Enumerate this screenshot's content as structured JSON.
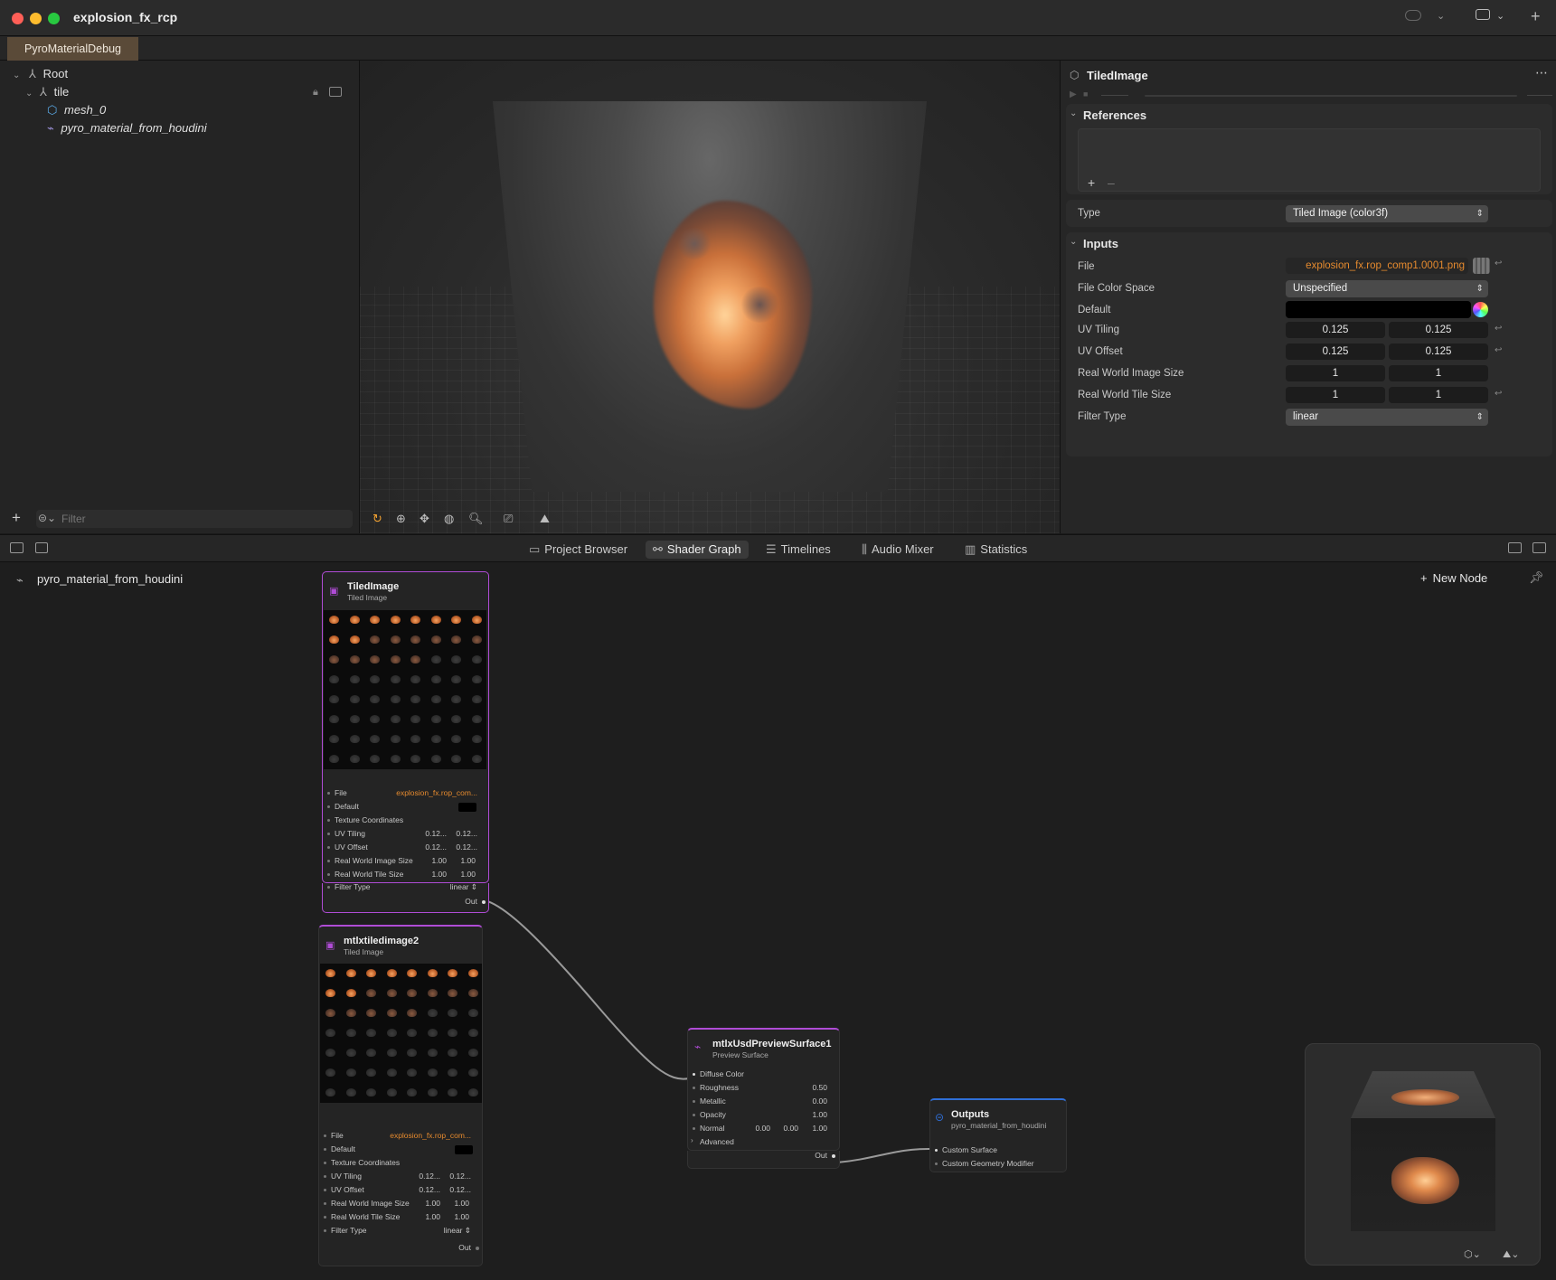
{
  "window": {
    "title": "explosion_fx_rcp"
  },
  "doc_tab": {
    "label": "PyroMaterialDebug"
  },
  "outliner": {
    "items": [
      {
        "label": "Root"
      },
      {
        "label": "tile"
      },
      {
        "label": "mesh_0"
      },
      {
        "label": "pyro_material_from_houdini"
      }
    ],
    "filter_placeholder": "Filter"
  },
  "inspector": {
    "title": "TiledImage",
    "references": {
      "header": "References"
    },
    "type": {
      "label": "Type",
      "value": "Tiled Image (color3f)"
    },
    "inputs": {
      "header": "Inputs",
      "file": {
        "label": "File",
        "value": "explosion_fx.rop_comp1.0001.png"
      },
      "file_color_space": {
        "label": "File Color Space",
        "value": "Unspecified"
      },
      "default": {
        "label": "Default",
        "color": "#000000"
      },
      "uv_tiling": {
        "label": "UV Tiling",
        "x": "0.125",
        "y": "0.125"
      },
      "uv_offset": {
        "label": "UV Offset",
        "x": "0.125",
        "y": "0.125"
      },
      "real_world_image_size": {
        "label": "Real World Image Size",
        "x": "1",
        "y": "1"
      },
      "real_world_tile_size": {
        "label": "Real World Tile Size",
        "x": "1",
        "y": "1"
      },
      "filter_type": {
        "label": "Filter Type",
        "value": "linear"
      }
    }
  },
  "bottom_tabs": [
    {
      "label": "Project Browser",
      "icon": "folder-icon"
    },
    {
      "label": "Shader Graph",
      "icon": "graph-icon",
      "active": true
    },
    {
      "label": "Timelines",
      "icon": "timeline-icon"
    },
    {
      "label": "Audio Mixer",
      "icon": "audio-icon"
    },
    {
      "label": "Statistics",
      "icon": "chart-icon"
    }
  ],
  "graph": {
    "material_name": "pyro_material_from_houdini",
    "new_node_label": "New Node",
    "nodes": {
      "tiled_image": {
        "title": "TiledImage",
        "subtitle": "Tiled Image",
        "rows": {
          "file": {
            "label": "File",
            "value": "explosion_fx.rop_com..."
          },
          "default": {
            "label": "Default"
          },
          "texcoord": {
            "label": "Texture Coordinates"
          },
          "uv_tiling": {
            "label": "UV Tiling",
            "x": "0.12...",
            "y": "0.12..."
          },
          "uv_offset": {
            "label": "UV Offset",
            "x": "0.12...",
            "y": "0.12..."
          },
          "rw_image": {
            "label": "Real World Image Size",
            "x": "1.00",
            "y": "1.00"
          },
          "rw_tile": {
            "label": "Real World Tile Size",
            "x": "1.00",
            "y": "1.00"
          },
          "filter": {
            "label": "Filter Type",
            "value": "linear"
          },
          "out": {
            "label": "Out"
          }
        }
      },
      "tiled_image2": {
        "title": "mtlxtiledimage2",
        "subtitle": "Tiled Image",
        "rows": {
          "file": {
            "label": "File",
            "value": "explosion_fx.rop_com..."
          },
          "default": {
            "label": "Default"
          },
          "texcoord": {
            "label": "Texture Coordinates"
          },
          "uv_tiling": {
            "label": "UV Tiling",
            "x": "0.12...",
            "y": "0.12..."
          },
          "uv_offset": {
            "label": "UV Offset",
            "x": "0.12...",
            "y": "0.12..."
          },
          "rw_image": {
            "label": "Real World Image Size",
            "x": "1.00",
            "y": "1.00"
          },
          "rw_tile": {
            "label": "Real World Tile Size",
            "x": "1.00",
            "y": "1.00"
          },
          "filter": {
            "label": "Filter Type",
            "value": "linear"
          },
          "out": {
            "label": "Out"
          }
        }
      },
      "preview_surface": {
        "title": "mtlxUsdPreviewSurface1",
        "subtitle": "Preview Surface",
        "rows": {
          "diffuse": {
            "label": "Diffuse Color"
          },
          "roughness": {
            "label": "Roughness",
            "value": "0.50"
          },
          "metallic": {
            "label": "Metallic",
            "value": "0.00"
          },
          "opacity": {
            "label": "Opacity",
            "value": "1.00"
          },
          "normal": {
            "label": "Normal",
            "x": "0.00",
            "y": "0.00",
            "z": "1.00"
          },
          "advanced": {
            "label": "Advanced"
          },
          "out": {
            "label": "Out"
          }
        }
      },
      "outputs": {
        "title": "Outputs",
        "subtitle": "pyro_material_from_houdini",
        "rows": {
          "custom_surface": {
            "label": "Custom Surface"
          },
          "custom_geometry": {
            "label": "Custom Geometry Modifier"
          }
        }
      }
    }
  },
  "colors": {
    "accent_purple": "#b04cd6",
    "outputs_blue": "#2f6fd8",
    "file_orange": "#e58a2e",
    "doc_tab": "#5a4a38"
  }
}
